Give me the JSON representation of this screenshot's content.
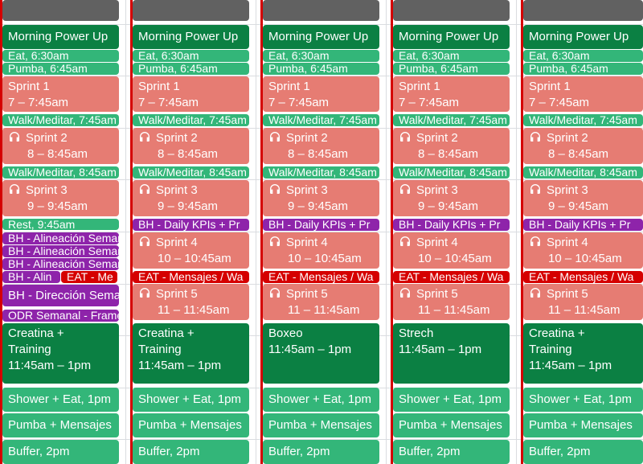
{
  "colors": {
    "green": "#33b679",
    "dark_green": "#0b8043",
    "salmon": "#e67c73",
    "purple": "#8e24aa",
    "red": "#d50000",
    "gray": "#616161",
    "grid": "#dadce0"
  },
  "columns": [
    {
      "events": [
        {
          "title": "Morning Power Up",
          "time": "",
          "color": "dark"
        },
        {
          "title": "Eat",
          "time": "6:30am",
          "color": "green"
        },
        {
          "title": "Pumba",
          "time": "6:45am",
          "color": "green"
        },
        {
          "title": "Sprint 1",
          "time": "7 – 7:45am",
          "color": "salmon",
          "icon": false
        },
        {
          "title": "Walk/Meditar",
          "time": "7:45am",
          "color": "green"
        },
        {
          "title": "Sprint 2",
          "time": "8 – 8:45am",
          "color": "salmon",
          "icon": true
        },
        {
          "title": "Walk/Meditar",
          "time": "8:45am",
          "color": "green"
        },
        {
          "title": "Sprint 3",
          "time": "9 – 9:45am",
          "color": "salmon",
          "icon": true
        },
        {
          "title": "Rest",
          "time": "9:45am",
          "color": "green"
        },
        {
          "title": "BH - Alineación Semanal",
          "time": "",
          "color": "purple"
        },
        {
          "title": "BH - Alineación Semanal",
          "time": "",
          "color": "purple"
        },
        {
          "title": "BH - Alineación Semanal",
          "time": "",
          "color": "purple"
        },
        {
          "title": "BH - Alin",
          "time": "",
          "color": "purple"
        },
        {
          "title": "EAT - Me",
          "time": "",
          "color": "red"
        },
        {
          "title": "BH - Dirección Semanal",
          "time": "",
          "color": "purple"
        },
        {
          "title": "ODR Semanal - Framework",
          "time": "",
          "color": "purple"
        },
        {
          "title": "Creatina + Training",
          "time": "11:45am – 1pm",
          "color": "dark"
        },
        {
          "title": "Shower + Eat",
          "time": "1pm",
          "color": "green"
        },
        {
          "title": "Pumba + Mensajes",
          "time": "",
          "color": "green"
        },
        {
          "title": "Buffer",
          "time": "2pm",
          "color": "green"
        }
      ]
    },
    {
      "events": [
        {
          "title": "Morning Power Up",
          "time": "",
          "color": "dark"
        },
        {
          "title": "Eat",
          "time": "6:30am",
          "color": "green"
        },
        {
          "title": "Pumba",
          "time": "6:45am",
          "color": "green"
        },
        {
          "title": "Sprint 1",
          "time": "7 – 7:45am",
          "color": "salmon"
        },
        {
          "title": "Walk/Meditar",
          "time": "7:45am",
          "color": "green"
        },
        {
          "title": "Sprint 2",
          "time": "8 – 8:45am",
          "color": "salmon"
        },
        {
          "title": "Walk/Meditar",
          "time": "8:45am",
          "color": "green"
        },
        {
          "title": "Sprint 3",
          "time": "9 – 9:45am",
          "color": "salmon"
        },
        {
          "title": "BH - Daily KPIs + Pr",
          "time": "",
          "color": "purple"
        },
        {
          "title": "Sprint 4",
          "time": "10 – 10:45am",
          "color": "salmon"
        },
        {
          "title": "EAT - Mensajes / Wa",
          "time": "",
          "color": "red"
        },
        {
          "title": "Sprint 5",
          "time": "11 – 11:45am",
          "color": "salmon"
        },
        {
          "title": "Creatina + Training",
          "time": "11:45am – 1pm",
          "color": "dark"
        },
        {
          "title": "Shower + Eat",
          "time": "1pm",
          "color": "green"
        },
        {
          "title": "Pumba + Mensajes",
          "time": "",
          "color": "green"
        },
        {
          "title": "Buffer",
          "time": "2pm",
          "color": "green"
        }
      ]
    },
    {
      "events": [
        {
          "title": "Morning Power Up",
          "time": "",
          "color": "dark"
        },
        {
          "title": "Eat",
          "time": "6:30am",
          "color": "green"
        },
        {
          "title": "Pumba",
          "time": "6:45am",
          "color": "green"
        },
        {
          "title": "Sprint 1",
          "time": "7 – 7:45am",
          "color": "salmon"
        },
        {
          "title": "Walk/Meditar",
          "time": "7:45am",
          "color": "green"
        },
        {
          "title": "Sprint 2",
          "time": "8 – 8:45am",
          "color": "salmon"
        },
        {
          "title": "Walk/Meditar",
          "time": "8:45am",
          "color": "green"
        },
        {
          "title": "Sprint 3",
          "time": "9 – 9:45am",
          "color": "salmon"
        },
        {
          "title": "BH - Daily KPIs + Pr",
          "time": "",
          "color": "purple"
        },
        {
          "title": "Sprint 4",
          "time": "10 – 10:45am",
          "color": "salmon"
        },
        {
          "title": "EAT - Mensajes / Wa",
          "time": "",
          "color": "red"
        },
        {
          "title": "Sprint 5",
          "time": "11 – 11:45am",
          "color": "salmon"
        },
        {
          "title": "Boxeo",
          "time": "11:45am – 1pm",
          "color": "dark"
        },
        {
          "title": "Shower + Eat",
          "time": "1pm",
          "color": "green"
        },
        {
          "title": "Pumba + Mensajes",
          "time": "",
          "color": "green"
        },
        {
          "title": "Buffer",
          "time": "2pm",
          "color": "green"
        }
      ]
    },
    {
      "events": [
        {
          "title": "Morning Power Up",
          "time": "",
          "color": "dark"
        },
        {
          "title": "Eat",
          "time": "6:30am",
          "color": "green"
        },
        {
          "title": "Pumba",
          "time": "6:45am",
          "color": "green"
        },
        {
          "title": "Sprint 1",
          "time": "7 – 7:45am",
          "color": "salmon"
        },
        {
          "title": "Walk/Meditar",
          "time": "7:45am",
          "color": "green"
        },
        {
          "title": "Sprint 2",
          "time": "8 – 8:45am",
          "color": "salmon"
        },
        {
          "title": "Walk/Meditar",
          "time": "8:45am",
          "color": "green"
        },
        {
          "title": "Sprint 3",
          "time": "9 – 9:45am",
          "color": "salmon"
        },
        {
          "title": "BH - Daily KPIs + Pr",
          "time": "",
          "color": "purple"
        },
        {
          "title": "Sprint 4",
          "time": "10 – 10:45am",
          "color": "salmon"
        },
        {
          "title": "EAT - Mensajes / Wa",
          "time": "",
          "color": "red"
        },
        {
          "title": "Sprint 5",
          "time": "11 – 11:45am",
          "color": "salmon"
        },
        {
          "title": "Strech",
          "time": "11:45am – 1pm",
          "color": "dark"
        },
        {
          "title": "Shower + Eat",
          "time": "1pm",
          "color": "green"
        },
        {
          "title": "Pumba + Mensajes",
          "time": "",
          "color": "green"
        },
        {
          "title": "Buffer",
          "time": "2pm",
          "color": "green"
        }
      ]
    },
    {
      "events": [
        {
          "title": "Morning Power Up",
          "time": "",
          "color": "dark"
        },
        {
          "title": "Eat",
          "time": "6:30am",
          "color": "green"
        },
        {
          "title": "Pumba",
          "time": "6:45am",
          "color": "green"
        },
        {
          "title": "Sprint 1",
          "time": "7 – 7:45am",
          "color": "salmon"
        },
        {
          "title": "Walk/Meditar",
          "time": "7:45am",
          "color": "green"
        },
        {
          "title": "Sprint 2",
          "time": "8 – 8:45am",
          "color": "salmon"
        },
        {
          "title": "Walk/Meditar",
          "time": "8:45am",
          "color": "green"
        },
        {
          "title": "Sprint 3",
          "time": "9 – 9:45am",
          "color": "salmon"
        },
        {
          "title": "BH - Daily KPIs + Pr",
          "time": "",
          "color": "purple"
        },
        {
          "title": "Sprint 4",
          "time": "10 – 10:45am",
          "color": "salmon"
        },
        {
          "title": "EAT - Mensajes / Wa",
          "time": "",
          "color": "red"
        },
        {
          "title": "Sprint 5",
          "time": "11 – 11:45am",
          "color": "salmon"
        },
        {
          "title": "Creatina + Training",
          "time": "11:45am – 1pm",
          "color": "dark"
        },
        {
          "title": "Shower + Eat",
          "time": "1pm",
          "color": "green"
        },
        {
          "title": "Pumba + Mensajes",
          "time": "",
          "color": "green"
        },
        {
          "title": "Buffer",
          "time": "2pm",
          "color": "green"
        }
      ]
    }
  ]
}
